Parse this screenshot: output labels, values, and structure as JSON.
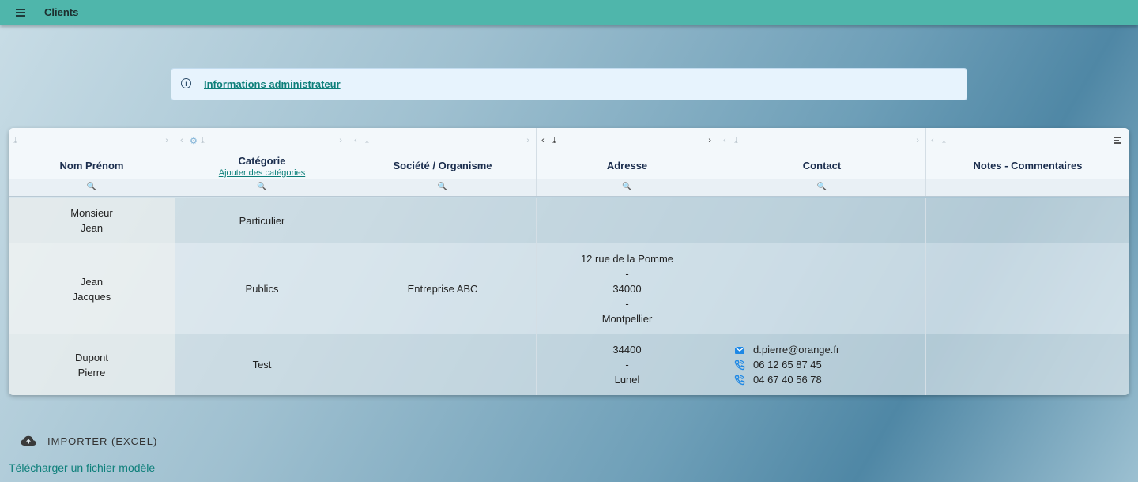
{
  "app": {
    "title": "Clients"
  },
  "info": {
    "link_label": "Informations administrateur"
  },
  "grid": {
    "columns": [
      {
        "label": "Nom Prénom",
        "sub": ""
      },
      {
        "label": "Catégorie",
        "sub": "Ajouter des catégories"
      },
      {
        "label": "Société / Organisme",
        "sub": ""
      },
      {
        "label": "Adresse",
        "sub": ""
      },
      {
        "label": "Contact",
        "sub": ""
      },
      {
        "label": "Notes - Commentaires",
        "sub": ""
      }
    ],
    "rows": [
      {
        "name": [
          "Monsieur",
          "Jean"
        ],
        "category": "Particulier",
        "company": "",
        "address": [],
        "contact": []
      },
      {
        "name": [
          "Jean",
          "Jacques"
        ],
        "category": "Publics",
        "company": "Entreprise ABC",
        "address": [
          "12 rue de la Pomme",
          "-",
          "34000",
          "-",
          "Montpellier"
        ],
        "contact": []
      },
      {
        "name": [
          "Dupont",
          "Pierre"
        ],
        "category": "Test",
        "company": "",
        "address": [
          "34400",
          "-",
          "Lunel"
        ],
        "contact": [
          {
            "type": "email",
            "icon": "email-icon",
            "value": "d.pierre@orange.fr"
          },
          {
            "type": "phone",
            "icon": "phone-icon",
            "value": "06 12 65 87 45"
          },
          {
            "type": "phone",
            "icon": "phone-icon",
            "value": "04 67 40 56 78"
          }
        ]
      }
    ]
  },
  "import": {
    "label": "IMPORTER (EXCEL)",
    "icon": "cloud-upload-icon"
  },
  "template_link": "Télécharger un fichier modèle",
  "colors": {
    "topbar": "#4fb6ab",
    "link": "#0d7f7a",
    "header_text": "#1a2d4d",
    "contact_icon": "#1e88e5"
  }
}
